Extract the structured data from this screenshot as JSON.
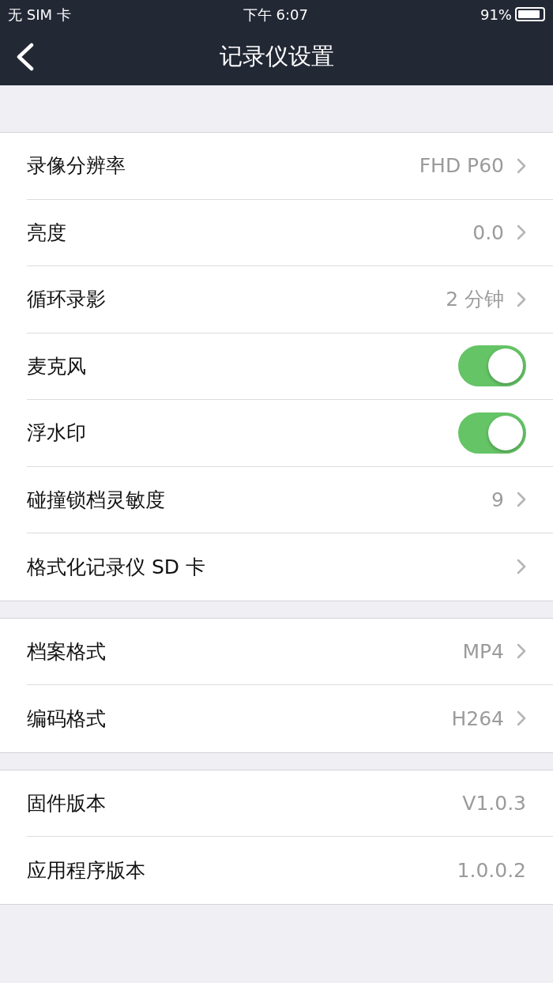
{
  "status_bar": {
    "carrier": "无 SIM 卡",
    "time": "下午 6:07",
    "battery": "91%"
  },
  "nav_bar": {
    "title": "记录仪设置"
  },
  "sections": [
    {
      "rows": [
        {
          "kind": "link",
          "label": "录像分辨率",
          "value": "FHD P60"
        },
        {
          "kind": "link",
          "label": "亮度",
          "value": "0.0"
        },
        {
          "kind": "link",
          "label": "循环录影",
          "value": "2 分钟"
        },
        {
          "kind": "toggle",
          "label": "麦克风",
          "on": true
        },
        {
          "kind": "toggle",
          "label": "浮水印",
          "on": true
        },
        {
          "kind": "link",
          "label": "碰撞锁档灵敏度",
          "value": "9"
        },
        {
          "kind": "link",
          "label": "格式化记录仪 SD 卡"
        }
      ]
    },
    {
      "rows": [
        {
          "kind": "link",
          "label": "档案格式",
          "value": "MP4"
        },
        {
          "kind": "link",
          "label": "编码格式",
          "value": "H264"
        }
      ]
    },
    {
      "rows": [
        {
          "kind": "info",
          "label": "固件版本",
          "value": "V1.0.3"
        },
        {
          "kind": "info",
          "label": "应用程序版本",
          "value": "1.0.0.2"
        }
      ]
    }
  ]
}
